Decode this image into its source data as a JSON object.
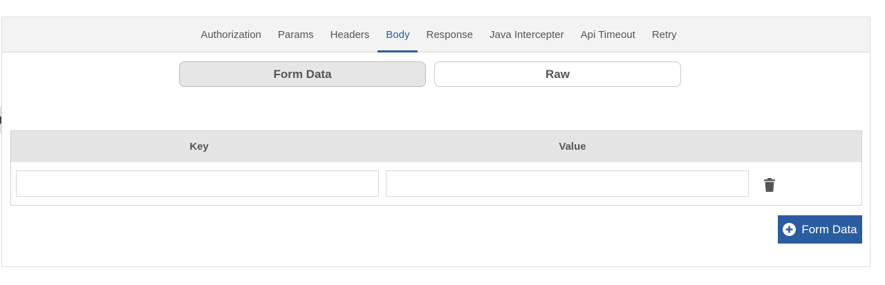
{
  "tabs": [
    {
      "label": "Authorization",
      "active": false
    },
    {
      "label": "Params",
      "active": false
    },
    {
      "label": "Headers",
      "active": false
    },
    {
      "label": "Body",
      "active": true
    },
    {
      "label": "Response",
      "active": false
    },
    {
      "label": "Java Intercepter",
      "active": false
    },
    {
      "label": "Api Timeout",
      "active": false
    },
    {
      "label": "Retry",
      "active": false
    }
  ],
  "body_mode": {
    "form_data_label": "Form Data",
    "raw_label": "Raw",
    "selected": "Form Data"
  },
  "table": {
    "key_header": "Key",
    "value_header": "Value",
    "rows": [
      {
        "key": "",
        "value": ""
      }
    ]
  },
  "add_button": {
    "label": "Form Data",
    "icon": "plus-circle-icon"
  },
  "colors": {
    "accent": "#2a5d9f",
    "tabbar_bg": "#f3f3f3",
    "header_bg": "#e5e5e5"
  }
}
